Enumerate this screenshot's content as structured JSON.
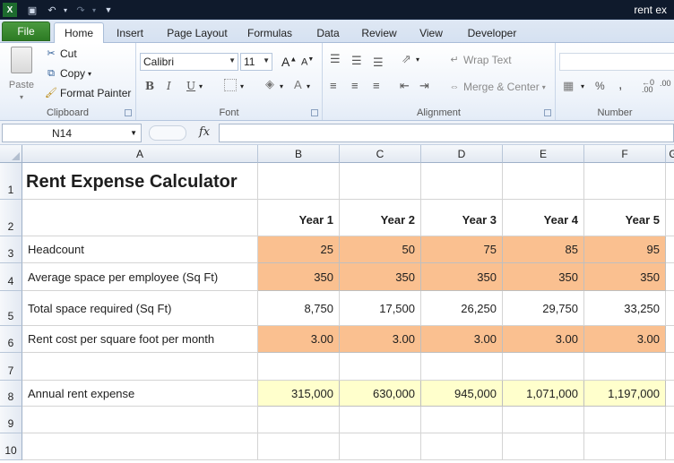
{
  "window": {
    "title": "rent ex"
  },
  "ribbon_tabs": [
    "File",
    "Home",
    "Insert",
    "Page Layout",
    "Formulas",
    "Data",
    "Review",
    "View",
    "Developer"
  ],
  "active_tab": "Home",
  "clipboard": {
    "paste": "Paste",
    "cut": "Cut",
    "copy": "Copy",
    "format_painter": "Format Painter",
    "label": "Clipboard"
  },
  "font": {
    "name": "Calibri",
    "size": "11",
    "label": "Font",
    "bold": "B",
    "italic": "I",
    "underline": "U"
  },
  "alignment": {
    "wrap_text": "Wrap Text",
    "merge_center": "Merge & Center",
    "label": "Alignment"
  },
  "number": {
    "label": "Number",
    "percent": "%",
    "comma": ","
  },
  "formula_bar": {
    "name_box": "N14",
    "fx": "fx",
    "formula": ""
  },
  "columns": [
    "A",
    "B",
    "C",
    "D",
    "E",
    "F",
    "G"
  ],
  "rows": [
    "1",
    "2",
    "3",
    "4",
    "5",
    "6",
    "7",
    "8",
    "9",
    "10"
  ],
  "sheet": {
    "title": "Rent Expense Calculator",
    "year_headers": [
      "Year 1",
      "Year 2",
      "Year 3",
      "Year 4",
      "Year 5"
    ],
    "lines": [
      {
        "label": "Headcount",
        "values": [
          "25",
          "50",
          "75",
          "85",
          "95"
        ],
        "style": "orange"
      },
      {
        "label": "Average space per employee (Sq Ft)",
        "values": [
          "350",
          "350",
          "350",
          "350",
          "350"
        ],
        "style": "orange"
      },
      {
        "label": "Total space required (Sq Ft)",
        "values": [
          "8,750",
          "17,500",
          "26,250",
          "29,750",
          "33,250"
        ],
        "style": "plain"
      },
      {
        "label": "Rent cost per square foot per month",
        "values": [
          "3.00",
          "3.00",
          "3.00",
          "3.00",
          "3.00"
        ],
        "style": "orange"
      },
      {
        "label": "Annual rent expense",
        "values": [
          "315,000",
          "630,000",
          "945,000",
          "1,071,000",
          "1,197,000"
        ],
        "style": "yellow"
      }
    ]
  },
  "colors": {
    "input_fill": "#fac090",
    "output_fill": "#ffffcc",
    "file_tab": "#2d7b24"
  }
}
